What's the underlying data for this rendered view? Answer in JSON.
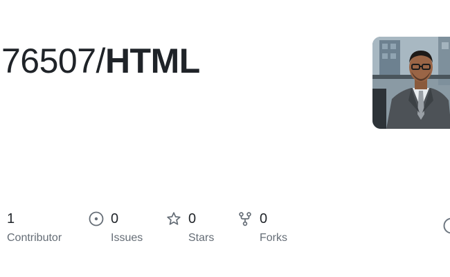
{
  "repo": {
    "owner": "76507",
    "separator": "/",
    "name": "HTML"
  },
  "avatar": {
    "alt": "owner-avatar"
  },
  "stats": {
    "contributors": {
      "count": "1",
      "label": "Contributor"
    },
    "issues": {
      "count": "0",
      "label": "Issues",
      "icon": "issue-opened-icon"
    },
    "stars": {
      "count": "0",
      "label": "Stars",
      "icon": "star-icon"
    },
    "forks": {
      "count": "0",
      "label": "Forks",
      "icon": "repo-forked-icon"
    }
  },
  "colors": {
    "text": "#1f2328",
    "muted": "#656d76",
    "icon": "#656d76",
    "background": "#ffffff"
  }
}
